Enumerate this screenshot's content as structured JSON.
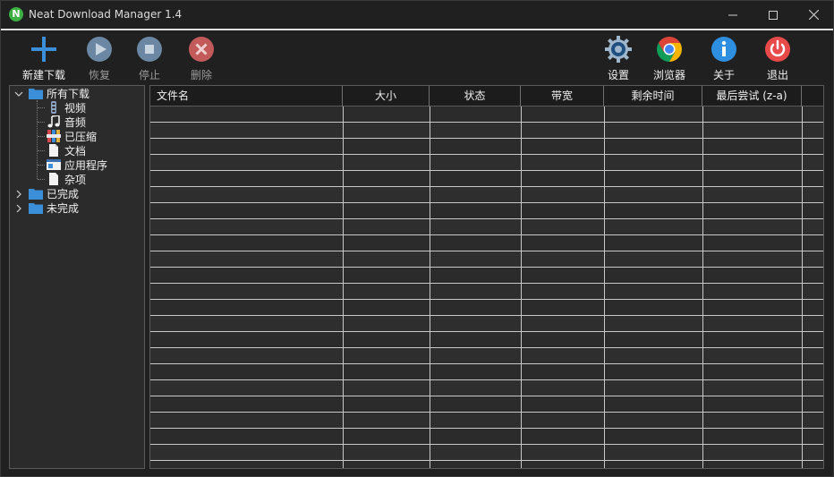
{
  "window": {
    "title": "Neat Download Manager 1.4",
    "logo_letter": "N",
    "controls": [
      "minimize-icon",
      "maximize-icon",
      "close-icon"
    ]
  },
  "toolbar": {
    "new_download": "新建下载",
    "resume": "恢复",
    "stop": "停止",
    "delete": "删除",
    "settings": "设置",
    "browser": "浏览器",
    "about": "关于",
    "exit": "退出"
  },
  "tree": {
    "all_downloads": "所有下载",
    "video": "视频",
    "audio": "音频",
    "compressed": "已压缩",
    "documents": "文档",
    "applications": "应用程序",
    "misc": "杂项",
    "completed": "已完成",
    "incomplete": "未完成"
  },
  "table": {
    "columns": [
      "文件名",
      "大小",
      "状态",
      "带宽",
      "剩余时间",
      "最后尝试 (z-a)"
    ],
    "rows": []
  },
  "colors": {
    "accent_blue": "#3a8fd8",
    "delete_red": "#d9534f",
    "exit_red": "#e84a4a",
    "app_green": "#3cb043"
  }
}
